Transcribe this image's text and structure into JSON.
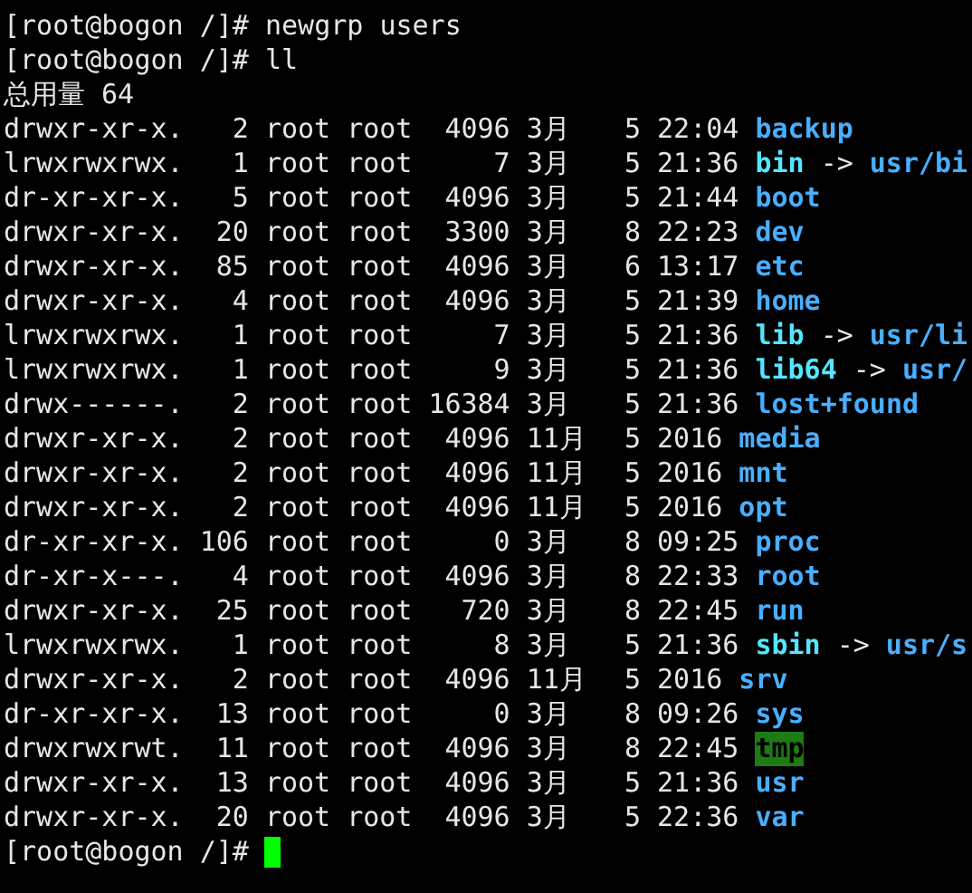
{
  "commands": [
    {
      "prompt": "[root@bogon /]#",
      "command": "newgrp users"
    },
    {
      "prompt": "[root@bogon /]#",
      "command": "ll"
    }
  ],
  "total": "总用量 64",
  "entries": [
    {
      "kind": "dir",
      "perms": "drwxr-xr-x.",
      "links": "2",
      "user": "root",
      "group": "root",
      "size": "4096",
      "month": "3月",
      "day": "5",
      "time": "22:04",
      "name": "backup"
    },
    {
      "kind": "link",
      "perms": "lrwxrwxrwx.",
      "links": "1",
      "user": "root",
      "group": "root",
      "size": "7",
      "month": "3月",
      "day": "5",
      "time": "21:36",
      "name": "bin",
      "arrow": "->",
      "target": "usr/bi"
    },
    {
      "kind": "dir",
      "perms": "dr-xr-xr-x.",
      "links": "5",
      "user": "root",
      "group": "root",
      "size": "4096",
      "month": "3月",
      "day": "5",
      "time": "21:44",
      "name": "boot"
    },
    {
      "kind": "dir",
      "perms": "drwxr-xr-x.",
      "links": "20",
      "user": "root",
      "group": "root",
      "size": "3300",
      "month": "3月",
      "day": "8",
      "time": "22:23",
      "name": "dev"
    },
    {
      "kind": "dir",
      "perms": "drwxr-xr-x.",
      "links": "85",
      "user": "root",
      "group": "root",
      "size": "4096",
      "month": "3月",
      "day": "6",
      "time": "13:17",
      "name": "etc"
    },
    {
      "kind": "dir",
      "perms": "drwxr-xr-x.",
      "links": "4",
      "user": "root",
      "group": "root",
      "size": "4096",
      "month": "3月",
      "day": "5",
      "time": "21:39",
      "name": "home"
    },
    {
      "kind": "link",
      "perms": "lrwxrwxrwx.",
      "links": "1",
      "user": "root",
      "group": "root",
      "size": "7",
      "month": "3月",
      "day": "5",
      "time": "21:36",
      "name": "lib",
      "arrow": "->",
      "target": "usr/li"
    },
    {
      "kind": "link",
      "perms": "lrwxrwxrwx.",
      "links": "1",
      "user": "root",
      "group": "root",
      "size": "9",
      "month": "3月",
      "day": "5",
      "time": "21:36",
      "name": "lib64",
      "arrow": "->",
      "target": "usr/"
    },
    {
      "kind": "dir",
      "perms": "drwx------.",
      "links": "2",
      "user": "root",
      "group": "root",
      "size": "16384",
      "month": "3月",
      "day": "5",
      "time": "21:36",
      "name": "lost+found"
    },
    {
      "kind": "dir",
      "perms": "drwxr-xr-x.",
      "links": "2",
      "user": "root",
      "group": "root",
      "size": "4096",
      "month": "11月",
      "day": "5",
      "time": "2016",
      "name": "media"
    },
    {
      "kind": "dir",
      "perms": "drwxr-xr-x.",
      "links": "2",
      "user": "root",
      "group": "root",
      "size": "4096",
      "month": "11月",
      "day": "5",
      "time": "2016",
      "name": "mnt"
    },
    {
      "kind": "dir",
      "perms": "drwxr-xr-x.",
      "links": "2",
      "user": "root",
      "group": "root",
      "size": "4096",
      "month": "11月",
      "day": "5",
      "time": "2016",
      "name": "opt"
    },
    {
      "kind": "dir",
      "perms": "dr-xr-xr-x.",
      "links": "106",
      "user": "root",
      "group": "root",
      "size": "0",
      "month": "3月",
      "day": "8",
      "time": "09:25",
      "name": "proc"
    },
    {
      "kind": "dir",
      "perms": "dr-xr-x---.",
      "links": "4",
      "user": "root",
      "group": "root",
      "size": "4096",
      "month": "3月",
      "day": "8",
      "time": "22:33",
      "name": "root"
    },
    {
      "kind": "dir",
      "perms": "drwxr-xr-x.",
      "links": "25",
      "user": "root",
      "group": "root",
      "size": "720",
      "month": "3月",
      "day": "8",
      "time": "22:45",
      "name": "run"
    },
    {
      "kind": "link",
      "perms": "lrwxrwxrwx.",
      "links": "1",
      "user": "root",
      "group": "root",
      "size": "8",
      "month": "3月",
      "day": "5",
      "time": "21:36",
      "name": "sbin",
      "arrow": "->",
      "target": "usr/s"
    },
    {
      "kind": "dir",
      "perms": "drwxr-xr-x.",
      "links": "2",
      "user": "root",
      "group": "root",
      "size": "4096",
      "month": "11月",
      "day": "5",
      "time": "2016",
      "name": "srv"
    },
    {
      "kind": "dir",
      "perms": "dr-xr-xr-x.",
      "links": "13",
      "user": "root",
      "group": "root",
      "size": "0",
      "month": "3月",
      "day": "8",
      "time": "09:26",
      "name": "sys"
    },
    {
      "kind": "sticky",
      "perms": "drwxrwxrwt.",
      "links": "11",
      "user": "root",
      "group": "root",
      "size": "4096",
      "month": "3月",
      "day": "8",
      "time": "22:45",
      "name": "tmp"
    },
    {
      "kind": "dir",
      "perms": "drwxr-xr-x.",
      "links": "13",
      "user": "root",
      "group": "root",
      "size": "4096",
      "month": "3月",
      "day": "5",
      "time": "21:36",
      "name": "usr"
    },
    {
      "kind": "dir",
      "perms": "drwxr-xr-x.",
      "links": "20",
      "user": "root",
      "group": "root",
      "size": "4096",
      "month": "3月",
      "day": "5",
      "time": "22:36",
      "name": "var"
    }
  ],
  "final_prompt": {
    "prompt": "[root@bogon /]#",
    "cursor": true
  }
}
